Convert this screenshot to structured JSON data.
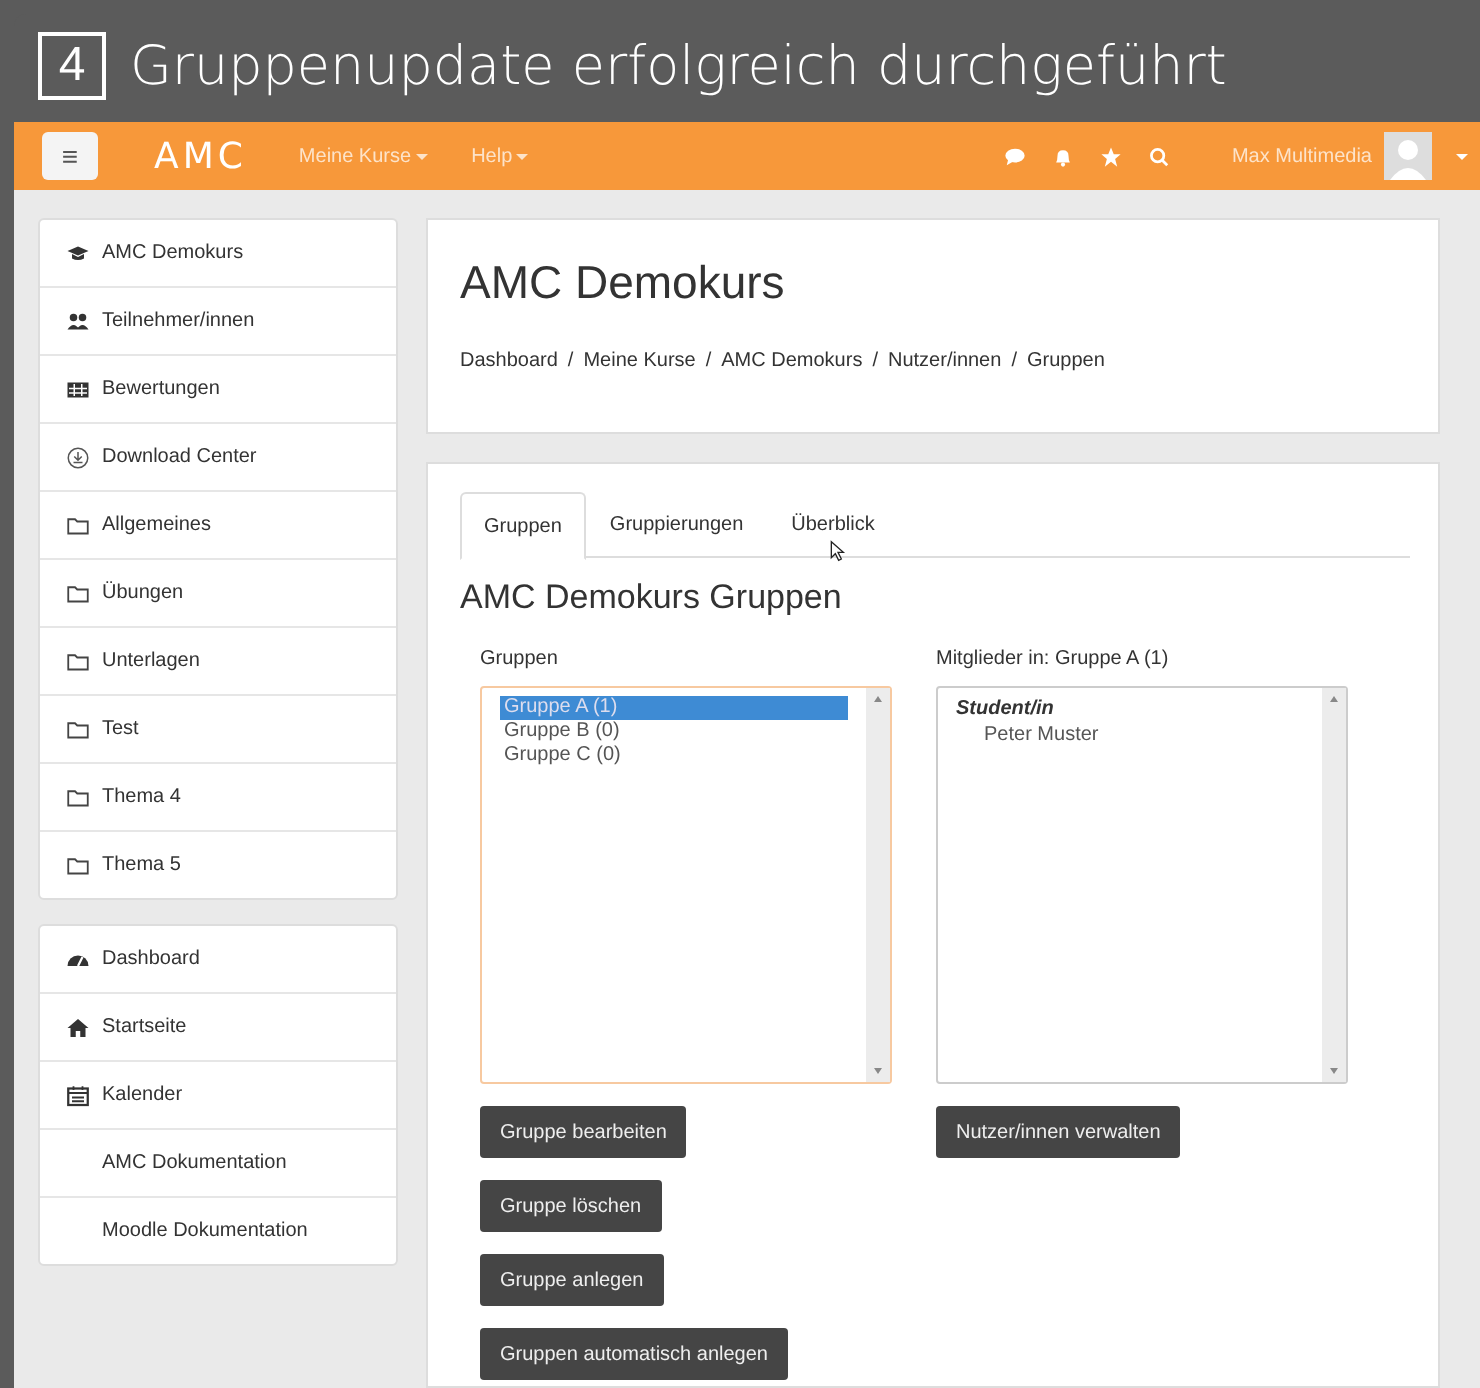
{
  "step": {
    "number": "4",
    "title": "Gruppenupdate erfolgreich durchgeführt"
  },
  "navbar": {
    "menu_glyph": "≡",
    "logo": "AMC",
    "menus": [
      {
        "label": "Meine Kurse"
      },
      {
        "label": "Help"
      }
    ],
    "icons": [
      {
        "kind": "comment"
      },
      {
        "kind": "bell"
      },
      {
        "kind": "star"
      },
      {
        "kind": "search"
      }
    ],
    "user": "Max Multimedia"
  },
  "sidebar": {
    "groups": [
      [
        {
          "label": "AMC Demokurs",
          "kind": "cap"
        },
        {
          "label": "Teilnehmer/innen",
          "kind": "users"
        },
        {
          "label": "Bewertungen",
          "kind": "table"
        },
        {
          "label": "Download Center",
          "kind": "download"
        },
        {
          "label": "Allgemeines",
          "kind": "folder"
        },
        {
          "label": "Übungen",
          "kind": "folder"
        },
        {
          "label": "Unterlagen",
          "kind": "folder"
        },
        {
          "label": "Test",
          "kind": "folder"
        },
        {
          "label": "Thema 4",
          "kind": "folder"
        },
        {
          "label": "Thema 5",
          "kind": "folder"
        }
      ],
      [
        {
          "label": "Dashboard",
          "kind": "dashboard"
        },
        {
          "label": "Startseite",
          "kind": "home"
        },
        {
          "label": "Kalender",
          "kind": "calendar"
        },
        {
          "label": "AMC Dokumentation",
          "kind": "plain"
        },
        {
          "label": "Moodle Dokumentation",
          "kind": "plain"
        }
      ]
    ]
  },
  "header": {
    "title": "AMC Demokurs",
    "breadcrumb": [
      "Dashboard",
      "Meine Kurse",
      "AMC Demokurs",
      "Nutzer/innen",
      "Gruppen"
    ],
    "separator": "/"
  },
  "tabs": [
    {
      "label": "Gruppen",
      "selected": true
    },
    {
      "label": "Gruppierungen",
      "selected": false
    },
    {
      "label": "Überblick",
      "selected": false
    }
  ],
  "section_title": "AMC Demokurs Gruppen",
  "groups_list": {
    "label": "Gruppen",
    "items": [
      {
        "text": "Gruppe A (1)",
        "selected": true
      },
      {
        "text": "Gruppe B (0)",
        "selected": false
      },
      {
        "text": "Gruppe C (0)",
        "selected": false
      }
    ]
  },
  "members_list": {
    "label": "Mitglieder in: Gruppe A (1)",
    "role": "Student/in",
    "members": [
      "Peter Muster"
    ]
  },
  "group_buttons": [
    "Gruppe bearbeiten",
    "Gruppe löschen",
    "Gruppe anlegen",
    "Gruppen automatisch anlegen"
  ],
  "member_buttons": [
    "Nutzer/innen verwalten"
  ]
}
